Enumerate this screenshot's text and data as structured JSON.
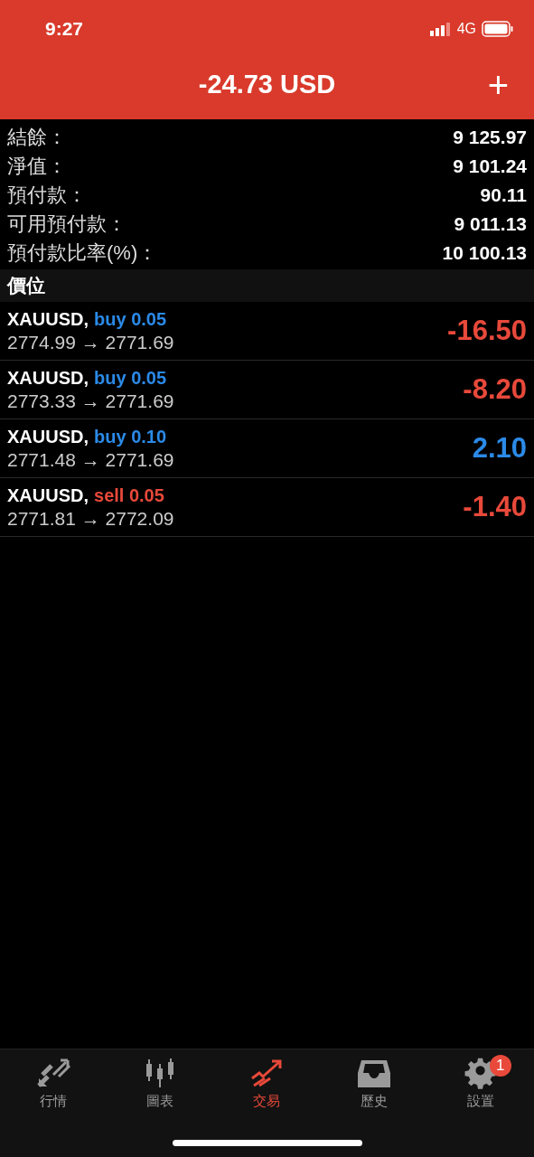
{
  "status_bar": {
    "time": "9:27",
    "network": "4G"
  },
  "header": {
    "title": "-24.73 USD",
    "add_button": "+"
  },
  "summary": [
    {
      "label": "結餘：",
      "value": "9 125.97"
    },
    {
      "label": "淨值：",
      "value": "9 101.24"
    },
    {
      "label": "預付款：",
      "value": "90.11"
    },
    {
      "label": "可用預付款：",
      "value": "9 011.13"
    },
    {
      "label": "預付款比率(%)：",
      "value": "10 100.13"
    }
  ],
  "section_title": "價位",
  "positions": [
    {
      "symbol": "XAUUSD,",
      "kind": "buy",
      "order": "buy 0.05",
      "prices": "2774.99 → 2771.69",
      "profit": "-16.50",
      "color": "#e8493a"
    },
    {
      "symbol": "XAUUSD,",
      "kind": "buy",
      "order": "buy 0.05",
      "prices": "2773.33 → 2771.69",
      "profit": "-8.20",
      "color": "#e8493a"
    },
    {
      "symbol": "XAUUSD,",
      "kind": "buy",
      "order": "buy 0.10",
      "prices": "2771.48 → 2771.69",
      "profit": "2.10",
      "color": "#2b8ae8"
    },
    {
      "symbol": "XAUUSD,",
      "kind": "sell",
      "order": "sell 0.05",
      "prices": "2771.81 → 2772.09",
      "profit": "-1.40",
      "color": "#e8493a"
    }
  ],
  "tabs": [
    {
      "label": "行情",
      "kind": "quotes",
      "selected": false
    },
    {
      "label": "圖表",
      "kind": "chart",
      "selected": false
    },
    {
      "label": "交易",
      "kind": "trade",
      "selected": true
    },
    {
      "label": "歷史",
      "kind": "history",
      "selected": false
    },
    {
      "label": "設置",
      "kind": "settings",
      "selected": false,
      "badge": "1"
    }
  ]
}
